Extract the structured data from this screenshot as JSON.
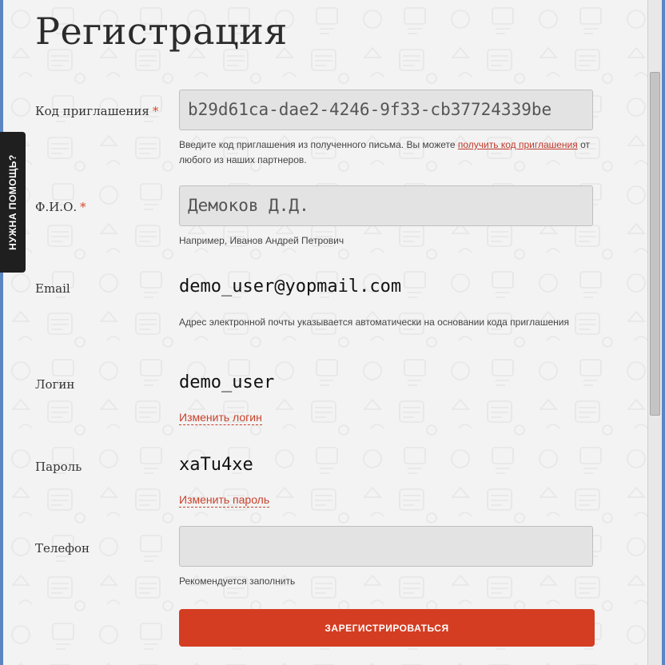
{
  "page": {
    "title": "Регистрация"
  },
  "help_tab": {
    "label": "НУЖНА ПОМОЩЬ?"
  },
  "fields": {
    "invite_code": {
      "label": "Код приглашения",
      "required_mark": "*",
      "value": "b29d61ca-dae2-4246-9f33-cb37724339be",
      "hint_before": "Введите код приглашения из полученного письма. Вы можете ",
      "hint_link": "получить код приглашения",
      "hint_after": " от любого из наших партнеров."
    },
    "full_name": {
      "label": "Ф.И.О.",
      "required_mark": "*",
      "value": "Демоков Д.Д.",
      "hint": "Например, Иванов Андрей Петрович"
    },
    "email": {
      "label": "Email",
      "value": "demo_user@yopmail.com",
      "hint": "Адрес электронной почты указывается автоматически на основании кода приглашения"
    },
    "login": {
      "label": "Логин",
      "value": "demo_user",
      "change_link": "Изменить логин"
    },
    "password": {
      "label": "Пароль",
      "value": "xaTu4xe",
      "change_link": "Изменить пароль"
    },
    "phone": {
      "label": "Телефон",
      "value": "",
      "hint": "Рекомендуется заполнить"
    }
  },
  "submit": {
    "label": "ЗАРЕГИСТРИРОВАТЬСЯ"
  },
  "colors": {
    "accent": "#d43d22",
    "link": "#c8412b",
    "background": "#f3f3f3",
    "input_bg": "#e3e3e3",
    "help_tab_bg": "#1f1f1f"
  }
}
